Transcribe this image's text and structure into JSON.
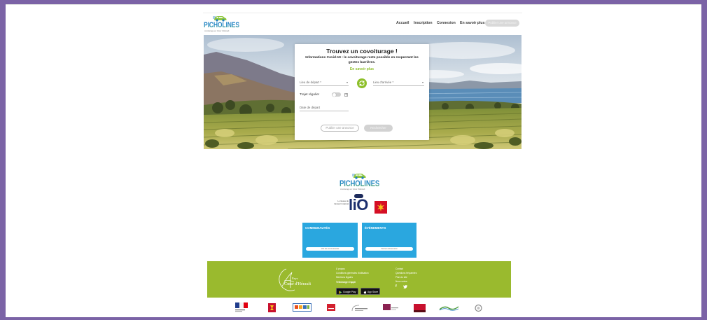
{
  "colors": {
    "frame": "#7b63a6",
    "brand_green": "#8dbf2a",
    "brand_blue": "#2a7fc0",
    "tile_blue": "#2aa7df",
    "footer_green": "#9aba2e"
  },
  "header": {
    "logo_icon": "car-icon",
    "logo_text": "PICHOLINES",
    "logo_tagline": "covoiturage en Cœur d'Hérault",
    "nav": [
      {
        "label": "Accueil"
      },
      {
        "label": "Inscription"
      },
      {
        "label": "Connexion"
      },
      {
        "label": "En savoir plus"
      }
    ],
    "publish_button": "Publier une annonce"
  },
  "search_card": {
    "title": "Trouvez un covoiturage !",
    "covid_notice": "Informations Covid-19 : le covoiturage reste possible en respectant les gestes barrières.",
    "more_link": "En savoir plus",
    "departure_placeholder": "Lieu de départ *",
    "arrival_placeholder": "Lieu d'arrivée *",
    "swap_icon": "swap-icon",
    "regular_trip_label": "Trajet régulier",
    "regular_trip_enabled": false,
    "date_placeholder": "Date de départ",
    "publish_button": "Publier une annonce",
    "search_button": "Rechercher"
  },
  "brand_block": {
    "logo_text": "PICHOLINES",
    "logo_tagline": "covoiturage en Cœur d'Hérault",
    "lio_caption": "Le réseau de transport régional",
    "lio_logo": "liO",
    "occitanie_logo": "occitanie-logo"
  },
  "tiles": [
    {
      "title": "COMMUNAUTÉS",
      "button": "Voir les communautés"
    },
    {
      "title": "ÉVÈNEMENTS",
      "button": "Voir les évènements"
    }
  ],
  "footer": {
    "pays_logo_small": "Pays",
    "pays_logo_name": "Cœur d'Hérault",
    "links_col1": [
      "À propos",
      "Conditions générales d'utilisation",
      "Mentions légales",
      "Télécharger l'appli"
    ],
    "links_col2": [
      "Contact",
      "Questions fréquentes",
      "Plan du site",
      "Nous suivre"
    ],
    "google_play": "Google Play",
    "app_store": "App Store",
    "social_icons": [
      "facebook-icon",
      "twitter-icon"
    ]
  },
  "partner_logos": [
    "republique-francaise-logo",
    "herault-logo",
    "vivre-logo",
    "red-partner-logo",
    "pezenas-logo",
    "maroon-partner-logo",
    "region-red-logo",
    "vallee-herault-logo",
    "circle-partner-logo"
  ]
}
